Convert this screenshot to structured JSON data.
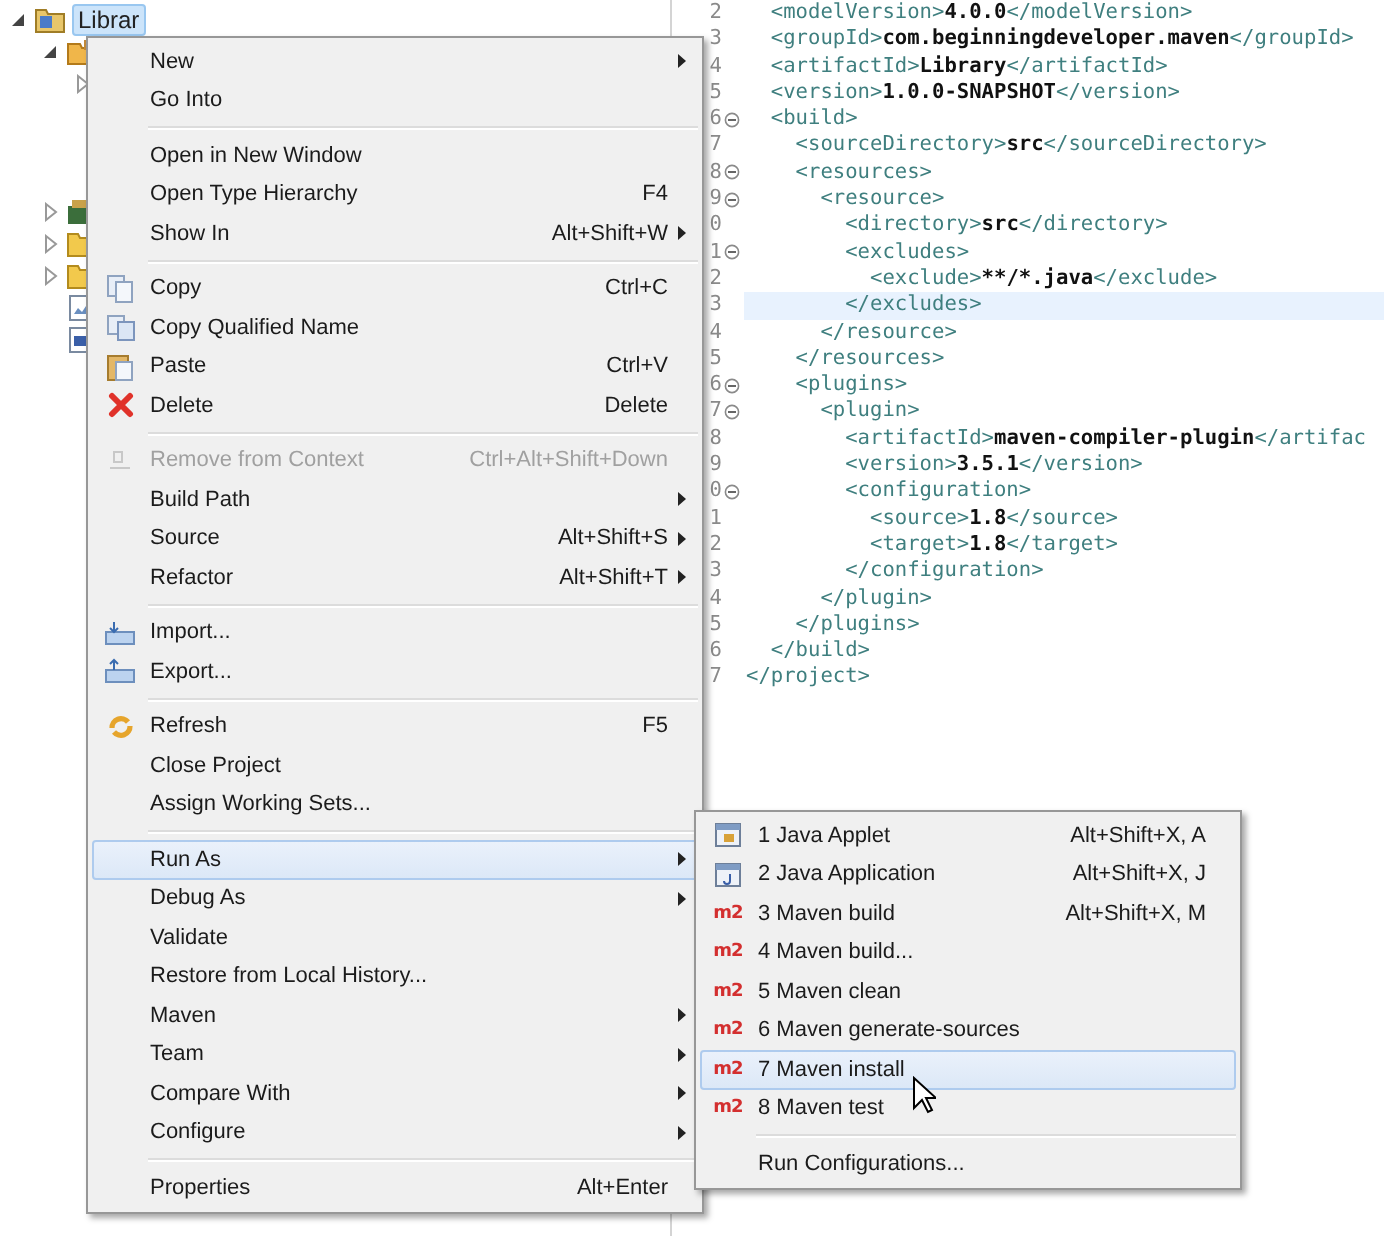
{
  "project_tree": {
    "items": [
      {
        "label": "Librar",
        "kind": "project",
        "expanded": true,
        "selected": true,
        "children": [
          {
            "kind": "package",
            "expanded": true,
            "children": [
              {
                "expanded": false
              }
            ]
          },
          {
            "kind": "library",
            "expanded": false
          },
          {
            "kind": "folder",
            "expanded": false
          },
          {
            "kind": "folder",
            "expanded": false
          },
          {
            "kind": "image-file"
          },
          {
            "kind": "xml-file"
          }
        ]
      }
    ]
  },
  "editor": {
    "lines": [
      {
        "number": "2",
        "fold": false,
        "current": false,
        "parts": [
          {
            "kind": "tag",
            "text": "  <modelVersion>"
          },
          {
            "kind": "value",
            "text": "4.0.0"
          },
          {
            "kind": "tag",
            "text": "</modelVersion>"
          }
        ]
      },
      {
        "number": "3",
        "fold": false,
        "current": false,
        "parts": [
          {
            "kind": "tag",
            "text": "  <groupId>"
          },
          {
            "kind": "value",
            "text": "com.beginningdeveloper.maven"
          },
          {
            "kind": "tag",
            "text": "</groupId>"
          }
        ]
      },
      {
        "number": "4",
        "fold": false,
        "current": false,
        "parts": [
          {
            "kind": "tag",
            "text": "  <artifactId>"
          },
          {
            "kind": "value",
            "text": "Library"
          },
          {
            "kind": "tag",
            "text": "</artifactId>"
          }
        ]
      },
      {
        "number": "5",
        "fold": false,
        "current": false,
        "parts": [
          {
            "kind": "tag",
            "text": "  <version>"
          },
          {
            "kind": "value",
            "text": "1.0.0-SNAPSHOT"
          },
          {
            "kind": "tag",
            "text": "</version>"
          }
        ]
      },
      {
        "number": "6",
        "fold": true,
        "current": false,
        "parts": [
          {
            "kind": "tag",
            "text": "  <build>"
          }
        ]
      },
      {
        "number": "7",
        "fold": false,
        "current": false,
        "parts": [
          {
            "kind": "tag",
            "text": "    <sourceDirectory>"
          },
          {
            "kind": "value",
            "text": "src"
          },
          {
            "kind": "tag",
            "text": "</sourceDirectory>"
          }
        ]
      },
      {
        "number": "8",
        "fold": true,
        "current": false,
        "parts": [
          {
            "kind": "tag",
            "text": "    <resources>"
          }
        ]
      },
      {
        "number": "9",
        "fold": true,
        "current": false,
        "parts": [
          {
            "kind": "tag",
            "text": "      <resource>"
          }
        ]
      },
      {
        "number": "0",
        "fold": false,
        "current": false,
        "parts": [
          {
            "kind": "tag",
            "text": "        <directory>"
          },
          {
            "kind": "value",
            "text": "src"
          },
          {
            "kind": "tag",
            "text": "</directory>"
          }
        ]
      },
      {
        "number": "1",
        "fold": true,
        "current": false,
        "parts": [
          {
            "kind": "tag",
            "text": "        <excludes>"
          }
        ]
      },
      {
        "number": "2",
        "fold": false,
        "current": false,
        "parts": [
          {
            "kind": "tag",
            "text": "          <exclude>"
          },
          {
            "kind": "value",
            "text": "**/*.java"
          },
          {
            "kind": "tag",
            "text": "</exclude>"
          }
        ]
      },
      {
        "number": "3",
        "fold": false,
        "current": true,
        "parts": [
          {
            "kind": "tag",
            "text": "        </excludes>"
          }
        ]
      },
      {
        "number": "4",
        "fold": false,
        "current": false,
        "parts": [
          {
            "kind": "tag",
            "text": "      </resource>"
          }
        ]
      },
      {
        "number": "5",
        "fold": false,
        "current": false,
        "parts": [
          {
            "kind": "tag",
            "text": "    </resources>"
          }
        ]
      },
      {
        "number": "6",
        "fold": true,
        "current": false,
        "parts": [
          {
            "kind": "tag",
            "text": "    <plugins>"
          }
        ]
      },
      {
        "number": "7",
        "fold": true,
        "current": false,
        "parts": [
          {
            "kind": "tag",
            "text": "      <plugin>"
          }
        ]
      },
      {
        "number": "8",
        "fold": false,
        "current": false,
        "parts": [
          {
            "kind": "tag",
            "text": "        <artifactId>"
          },
          {
            "kind": "value",
            "text": "maven-compiler-plugin"
          },
          {
            "kind": "tag",
            "text": "</artifac"
          }
        ]
      },
      {
        "number": "9",
        "fold": false,
        "current": false,
        "parts": [
          {
            "kind": "tag",
            "text": "        <version>"
          },
          {
            "kind": "value",
            "text": "3.5.1"
          },
          {
            "kind": "tag",
            "text": "</version>"
          }
        ]
      },
      {
        "number": "0",
        "fold": true,
        "current": false,
        "parts": [
          {
            "kind": "tag",
            "text": "        <configuration>"
          }
        ]
      },
      {
        "number": "1",
        "fold": false,
        "current": false,
        "parts": [
          {
            "kind": "tag",
            "text": "          <source>"
          },
          {
            "kind": "value",
            "text": "1.8"
          },
          {
            "kind": "tag",
            "text": "</source>"
          }
        ]
      },
      {
        "number": "2",
        "fold": false,
        "current": false,
        "parts": [
          {
            "kind": "tag",
            "text": "          <target>"
          },
          {
            "kind": "value",
            "text": "1.8"
          },
          {
            "kind": "tag",
            "text": "</target>"
          }
        ]
      },
      {
        "number": "3",
        "fold": false,
        "current": false,
        "parts": [
          {
            "kind": "tag",
            "text": "        </configuration>"
          }
        ]
      },
      {
        "number": "4",
        "fold": false,
        "current": false,
        "parts": [
          {
            "kind": "tag",
            "text": "      </plugin>"
          }
        ]
      },
      {
        "number": "5",
        "fold": false,
        "current": false,
        "parts": [
          {
            "kind": "tag",
            "text": "    </plugins>"
          }
        ]
      },
      {
        "number": "6",
        "fold": false,
        "current": false,
        "parts": [
          {
            "kind": "tag",
            "text": "  </build>"
          }
        ]
      },
      {
        "number": "7",
        "fold": false,
        "current": false,
        "parts": [
          {
            "kind": "tag",
            "text": "</project>"
          }
        ]
      }
    ]
  },
  "context_menu": {
    "groups": [
      [
        {
          "label": "New",
          "kind": "plain",
          "submenu": true,
          "disabled": false,
          "selected": false
        },
        {
          "label": "Go Into",
          "kind": "plain",
          "submenu": false,
          "disabled": false,
          "selected": false
        }
      ],
      [
        {
          "label": "Open in New Window",
          "kind": "plain",
          "submenu": false,
          "disabled": false,
          "selected": false
        },
        {
          "label": "Open Type Hierarchy",
          "kind": "plain",
          "shortcut": "F4",
          "submenu": false,
          "disabled": false,
          "selected": false
        },
        {
          "label": "Show In",
          "kind": "plain",
          "shortcut": "Alt+Shift+W",
          "submenu": true,
          "disabled": false,
          "selected": false
        }
      ],
      [
        {
          "label": "Copy",
          "kind": "copy",
          "shortcut": "Ctrl+C",
          "submenu": false,
          "disabled": false,
          "selected": false
        },
        {
          "label": "Copy Qualified Name",
          "kind": "copy-qualified",
          "submenu": false,
          "disabled": false,
          "selected": false
        },
        {
          "label": "Paste",
          "kind": "paste",
          "shortcut": "Ctrl+V",
          "submenu": false,
          "disabled": false,
          "selected": false
        },
        {
          "label": "Delete",
          "kind": "delete",
          "shortcut": "Delete",
          "submenu": false,
          "disabled": false,
          "selected": false
        }
      ],
      [
        {
          "label": "Remove from Context",
          "kind": "remove",
          "shortcut": "Ctrl+Alt+Shift+Down",
          "submenu": false,
          "disabled": true,
          "selected": false
        },
        {
          "label": "Build Path",
          "kind": "plain",
          "submenu": true,
          "disabled": false,
          "selected": false
        },
        {
          "label": "Source",
          "kind": "plain",
          "shortcut": "Alt+Shift+S",
          "submenu": true,
          "disabled": false,
          "selected": false
        },
        {
          "label": "Refactor",
          "kind": "plain",
          "shortcut": "Alt+Shift+T",
          "submenu": true,
          "disabled": false,
          "selected": false
        }
      ],
      [
        {
          "label": "Import...",
          "kind": "import",
          "submenu": false,
          "disabled": false,
          "selected": false
        },
        {
          "label": "Export...",
          "kind": "export",
          "submenu": false,
          "disabled": false,
          "selected": false
        }
      ],
      [
        {
          "label": "Refresh",
          "kind": "refresh",
          "shortcut": "F5",
          "submenu": false,
          "disabled": false,
          "selected": false
        },
        {
          "label": "Close Project",
          "kind": "plain",
          "submenu": false,
          "disabled": false,
          "selected": false
        },
        {
          "label": "Assign Working Sets...",
          "kind": "plain",
          "submenu": false,
          "disabled": false,
          "selected": false
        }
      ],
      [
        {
          "label": "Run As",
          "kind": "plain",
          "submenu": true,
          "disabled": false,
          "selected": true
        },
        {
          "label": "Debug As",
          "kind": "plain",
          "submenu": true,
          "disabled": false,
          "selected": false
        },
        {
          "label": "Validate",
          "kind": "plain",
          "submenu": false,
          "disabled": false,
          "selected": false
        },
        {
          "label": "Restore from Local History...",
          "kind": "plain",
          "submenu": false,
          "disabled": false,
          "selected": false
        },
        {
          "label": "Maven",
          "kind": "plain",
          "submenu": true,
          "disabled": false,
          "selected": false
        },
        {
          "label": "Team",
          "kind": "plain",
          "submenu": true,
          "disabled": false,
          "selected": false
        },
        {
          "label": "Compare With",
          "kind": "plain",
          "submenu": true,
          "disabled": false,
          "selected": false
        },
        {
          "label": "Configure",
          "kind": "plain",
          "submenu": true,
          "disabled": false,
          "selected": false
        }
      ],
      [
        {
          "label": "Properties",
          "kind": "plain",
          "shortcut": "Alt+Enter",
          "submenu": false,
          "disabled": false,
          "selected": false
        }
      ]
    ]
  },
  "run_as_menu": {
    "groups": [
      [
        {
          "label": "1 Java Applet",
          "kind": "applet",
          "shortcut": "Alt+Shift+X, A",
          "submenu": false,
          "disabled": false,
          "selected": false
        },
        {
          "label": "2 Java Application",
          "kind": "java-app",
          "shortcut": "Alt+Shift+X, J",
          "submenu": false,
          "disabled": false,
          "selected": false
        },
        {
          "label": "3 Maven build",
          "kind": "maven",
          "badge": "m2",
          "shortcut": "Alt+Shift+X, M",
          "submenu": false,
          "disabled": false,
          "selected": false
        },
        {
          "label": "4 Maven build...",
          "kind": "maven",
          "badge": "m2",
          "submenu": false,
          "disabled": false,
          "selected": false
        },
        {
          "label": "5 Maven clean",
          "kind": "maven",
          "badge": "m2",
          "submenu": false,
          "disabled": false,
          "selected": false
        },
        {
          "label": "6 Maven generate-sources",
          "kind": "maven",
          "badge": "m2",
          "submenu": false,
          "disabled": false,
          "selected": false
        },
        {
          "label": "7 Maven install",
          "kind": "maven",
          "badge": "m2",
          "submenu": false,
          "disabled": false,
          "selected": true
        },
        {
          "label": "8 Maven test",
          "kind": "maven",
          "badge": "m2",
          "submenu": false,
          "disabled": false,
          "selected": false
        }
      ],
      [
        {
          "label": "Run Configurations...",
          "kind": "plain",
          "submenu": false,
          "disabled": false,
          "selected": false
        }
      ]
    ]
  }
}
